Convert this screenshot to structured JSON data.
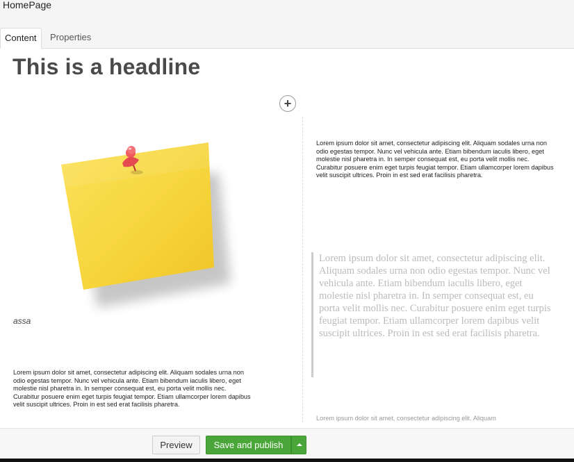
{
  "header": {
    "title": "HomePage"
  },
  "tabs": [
    {
      "label": "Content"
    },
    {
      "label": "Properties"
    }
  ],
  "content": {
    "headline": "This is a headline",
    "add_button": "+",
    "image_caption": "assa",
    "left_text": "Lorem ipsum dolor sit amet, consectetur adipiscing elit. Aliquam sodales urna non odio egestas tempor. Nunc vel vehicula ante. Etiam bibendum iaculis libero, eget molestie nisl pharetra in. In semper consequat est, eu porta velit mollis nec. Curabitur posuere enim eget turpis feugiat tempor. Etiam ullamcorper lorem dapibus velit suscipit ultrices. Proin in est sed erat facilisis pharetra.",
    "right_text_top": "Lorem ipsum dolor sit amet, consectetur adipiscing elit. Aliquam sodales urna non odio egestas tempor. Nunc vel vehicula ante. Etiam bibendum iaculis libero, eget molestie nisl pharetra in. In semper consequat est, eu porta velit mollis nec. Curabitur posuere enim eget turpis feugiat tempor. Etiam ullamcorper lorem dapibus velit suscipit ultrices. Proin in est sed erat facilisis pharetra.",
    "quote_text": "Lorem ipsum dolor sit amet, consectetur adipiscing elit. Aliquam sodales urna non odio egestas tempor. Nunc vel vehicula ante. Etiam bibendum iaculis libero, eget molestie nisl pharetra in. In semper consequat est, eu porta velit mollis nec. Curabitur posuere enim eget turpis feugiat tempor. Etiam ullamcorper lorem dapibus velit suscipit ultrices. Proin in est sed erat facilisis pharetra.",
    "right_text_bottom": "Lorem ipsum dolor sit amet, consectetur adipiscing elit. Aliquam"
  },
  "footer": {
    "preview_label": "Preview",
    "save_label": "Save and publish"
  },
  "colors": {
    "accent_green": "#4ba63a",
    "note_yellow": "#f7d63a",
    "pin_red": "#e84b50"
  }
}
